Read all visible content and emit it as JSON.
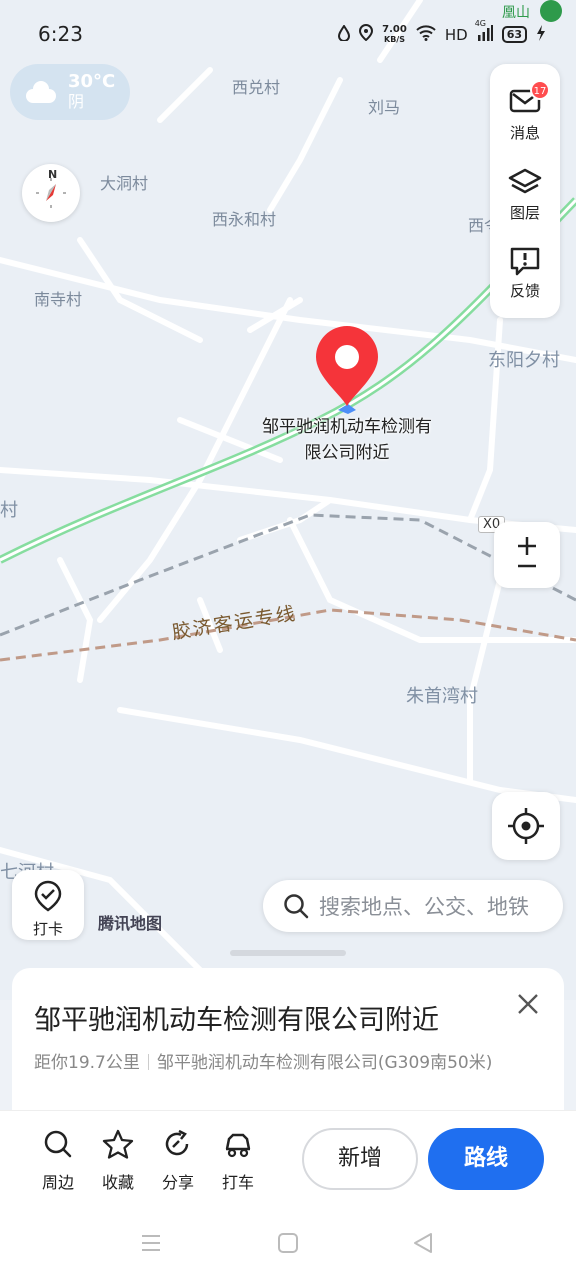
{
  "status_bar": {
    "time": "6:23",
    "speed_value": "7.00",
    "speed_unit": "KB/S",
    "hd": "HD",
    "signal": "4G",
    "battery": "63",
    "overlay_text": "凰山"
  },
  "weather": {
    "temp": "30°C",
    "condition": "阴"
  },
  "compass": {
    "north": "N"
  },
  "side_panel": {
    "messages_label": "消息",
    "messages_badge": "17",
    "layers_label": "图层",
    "feedback_label": "反馈"
  },
  "map": {
    "labels": {
      "xiduicun": "西兑村",
      "liuma": "刘马",
      "dadongcun": "大洞村",
      "xiyonghecun": "西永和村",
      "xi_partial": "西令",
      "nansicun": "南寺村",
      "dongyangxicun": "东阳夕村",
      "cun_partial": "村",
      "x0": "X0",
      "railway": "胶济客运专线",
      "zhushouwancun": "朱首湾村",
      "qihecun_partial": "七河村"
    },
    "pin_label": "邹平驰润机动车检测有限公司附近",
    "attribution": "腾讯地图"
  },
  "checkin": {
    "label": "打卡"
  },
  "search": {
    "placeholder": "搜索地点、公交、地铁"
  },
  "place": {
    "title": "邹平驰润机动车检测有限公司附近",
    "distance": "距你19.7公里",
    "address": "邹平驰润机动车检测有限公司(G309南50米)"
  },
  "actions": {
    "nearby": "周边",
    "favorite": "收藏",
    "share": "分享",
    "taxi": "打车",
    "add": "新增",
    "route": "路线"
  },
  "colors": {
    "accent": "#1f6ff0",
    "pin": "#f5343a",
    "highway": "#86dd9f",
    "badge": "#ff4d4f"
  }
}
